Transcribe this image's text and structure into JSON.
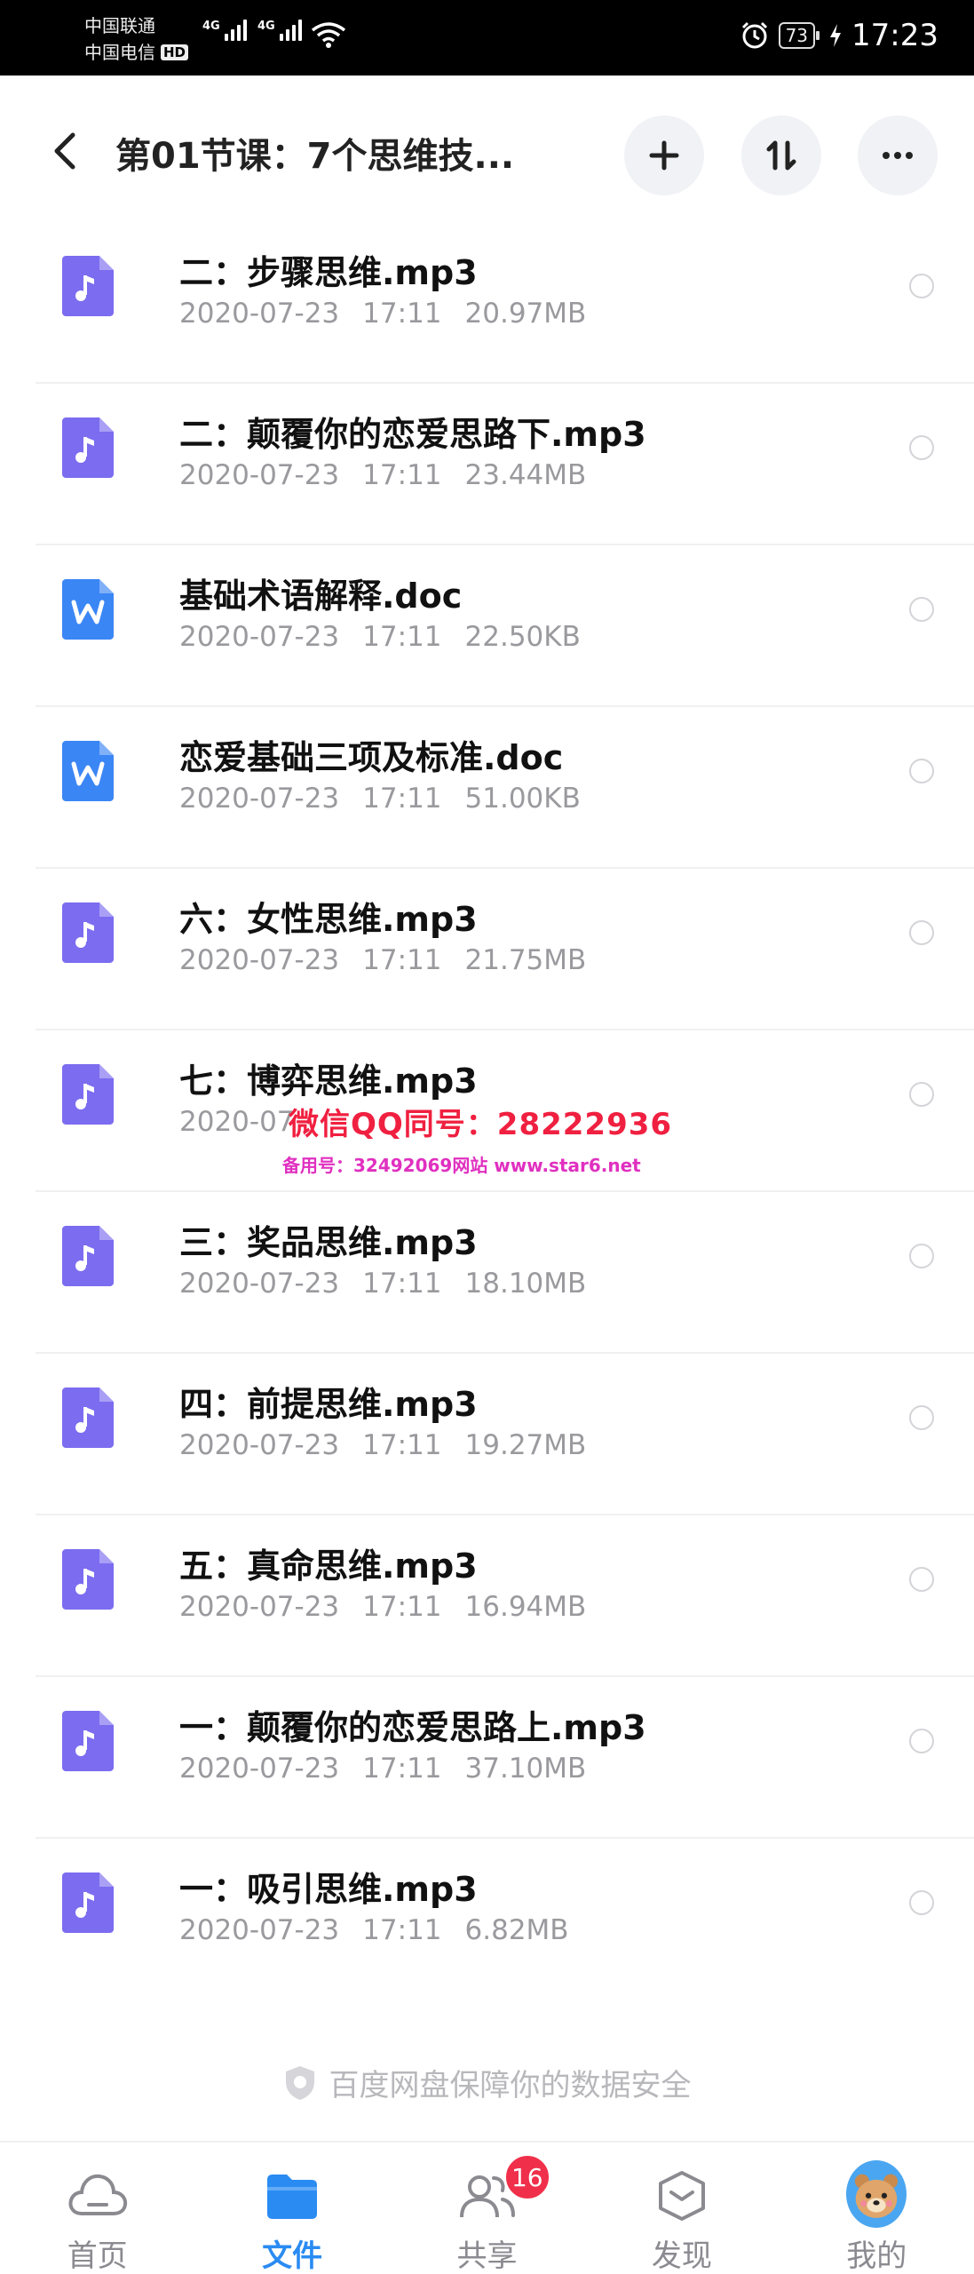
{
  "status_bar": {
    "carrier1": "中国联通",
    "carrier2": "中国电信",
    "hd": "HD",
    "net1": "4G",
    "net2": "4G",
    "battery": "73",
    "time": "17:23"
  },
  "header": {
    "title": "第01节课：7个思维技...",
    "icons": [
      "back-icon",
      "plus-icon",
      "sort-icon",
      "more-icon"
    ]
  },
  "files": [
    {
      "name": "二：步骤思维.mp3",
      "date": "2020-07-23",
      "time": "17:11",
      "size": "20.97MB",
      "type": "audio"
    },
    {
      "name": "二：颠覆你的恋爱思路下.mp3",
      "date": "2020-07-23",
      "time": "17:11",
      "size": "23.44MB",
      "type": "audio"
    },
    {
      "name": "基础术语解释.doc",
      "date": "2020-07-23",
      "time": "17:11",
      "size": "22.50KB",
      "type": "word"
    },
    {
      "name": "恋爱基础三项及标准.doc",
      "date": "2020-07-23",
      "time": "17:11",
      "size": "51.00KB",
      "type": "word"
    },
    {
      "name": "六：女性思维.mp3",
      "date": "2020-07-23",
      "time": "17:11",
      "size": "21.75MB",
      "type": "audio"
    },
    {
      "name": "七：博弈思维.mp3",
      "date": "2020-07",
      "time": "",
      "size": "",
      "type": "audio"
    },
    {
      "name": "三：奖品思维.mp3",
      "date": "2020-07-23",
      "time": "17:11",
      "size": "18.10MB",
      "type": "audio"
    },
    {
      "name": "四：前提思维.mp3",
      "date": "2020-07-23",
      "time": "17:11",
      "size": "19.27MB",
      "type": "audio"
    },
    {
      "name": "五：真命思维.mp3",
      "date": "2020-07-23",
      "time": "17:11",
      "size": "16.94MB",
      "type": "audio"
    },
    {
      "name": "一：颠覆你的恋爱思路上.mp3",
      "date": "2020-07-23",
      "time": "17:11",
      "size": "37.10MB",
      "type": "audio"
    },
    {
      "name": "一：吸引思维.mp3",
      "date": "2020-07-23",
      "time": "17:11",
      "size": "6.82MB",
      "type": "audio"
    }
  ],
  "watermark": {
    "main": "微信QQ同号：28222936",
    "sub": "备用号：32492069网站 www.star6.net"
  },
  "security_note": "百度网盘保障你的数据安全",
  "nav": {
    "items": [
      {
        "label": "首页",
        "icon": "cloud-icon"
      },
      {
        "label": "文件",
        "icon": "folder-icon"
      },
      {
        "label": "共享",
        "icon": "people-icon"
      },
      {
        "label": "发现",
        "icon": "discover-icon"
      },
      {
        "label": "我的",
        "icon": "avatar-icon"
      }
    ],
    "share_badge": "16"
  },
  "colors": {
    "audio_icon": "#7b6cf0",
    "word_icon": "#3b86f5",
    "accent": "#2a8bf2",
    "badge": "#f0304a"
  }
}
